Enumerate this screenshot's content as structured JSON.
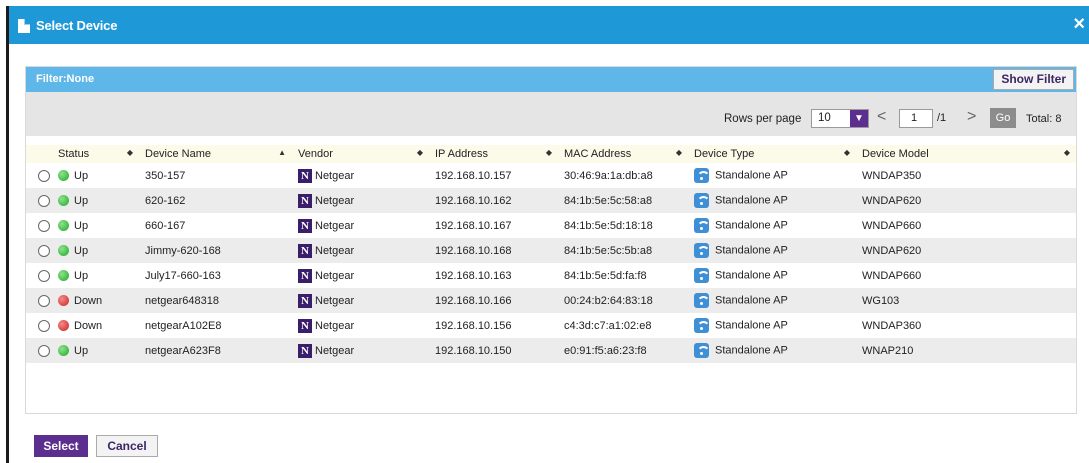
{
  "dialog": {
    "title": "Select Device",
    "close_symbol": "×"
  },
  "filter": {
    "label": "Filter:None",
    "show_filter_label": "Show Filter"
  },
  "pager": {
    "rows_per_page_label": "Rows per page",
    "rows_per_page_value": "10",
    "current_page": "1",
    "page_total": "/1",
    "go_label": "Go",
    "total_label": "Total: 8"
  },
  "table": {
    "headers": [
      "Status",
      "Device Name",
      "Vendor",
      "IP Address",
      "MAC Address",
      "Device Type",
      "Device Model"
    ],
    "sorted_column": "Device Name",
    "rows": [
      {
        "status": "Up",
        "name": "350-157",
        "vendor": "Netgear",
        "ip": "192.168.10.157",
        "mac": "30:46:9a:1a:db:a8",
        "type": "Standalone AP",
        "model": "WNDAP350"
      },
      {
        "status": "Up",
        "name": "620-162",
        "vendor": "Netgear",
        "ip": "192.168.10.162",
        "mac": "84:1b:5e:5c:58:a8",
        "type": "Standalone AP",
        "model": "WNDAP620"
      },
      {
        "status": "Up",
        "name": "660-167",
        "vendor": "Netgear",
        "ip": "192.168.10.167",
        "mac": "84:1b:5e:5d:18:18",
        "type": "Standalone AP",
        "model": "WNDAP660"
      },
      {
        "status": "Up",
        "name": "Jimmy-620-168",
        "vendor": "Netgear",
        "ip": "192.168.10.168",
        "mac": "84:1b:5e:5c:5b:a8",
        "type": "Standalone AP",
        "model": "WNDAP620"
      },
      {
        "status": "Up",
        "name": "July17-660-163",
        "vendor": "Netgear",
        "ip": "192.168.10.163",
        "mac": "84:1b:5e:5d:fa:f8",
        "type": "Standalone AP",
        "model": "WNDAP660"
      },
      {
        "status": "Down",
        "name": "netgear648318",
        "vendor": "Netgear",
        "ip": "192.168.10.166",
        "mac": "00:24:b2:64:83:18",
        "type": "Standalone AP",
        "model": "WG103"
      },
      {
        "status": "Down",
        "name": "netgearA102E8",
        "vendor": "Netgear",
        "ip": "192.168.10.156",
        "mac": "c4:3d:c7:a1:02:e8",
        "type": "Standalone AP",
        "model": "WNDAP360"
      },
      {
        "status": "Up",
        "name": "netgearA623F8",
        "vendor": "Netgear",
        "ip": "192.168.10.150",
        "mac": "e0:91:f5:a6:23:f8",
        "type": "Standalone AP",
        "model": "WNAP210"
      }
    ]
  },
  "footer": {
    "select_label": "Select",
    "cancel_label": "Cancel"
  },
  "colors": {
    "titlebar": "#1e98d7",
    "filterbar": "#5fb6e8",
    "brand_purple": "#5b2e8f",
    "status_up": "#1fa82b",
    "status_down": "#d11f1f"
  },
  "icons": {
    "title": "document-icon",
    "vendor": "netgear-logo-icon",
    "device_type": "wifi-icon"
  }
}
